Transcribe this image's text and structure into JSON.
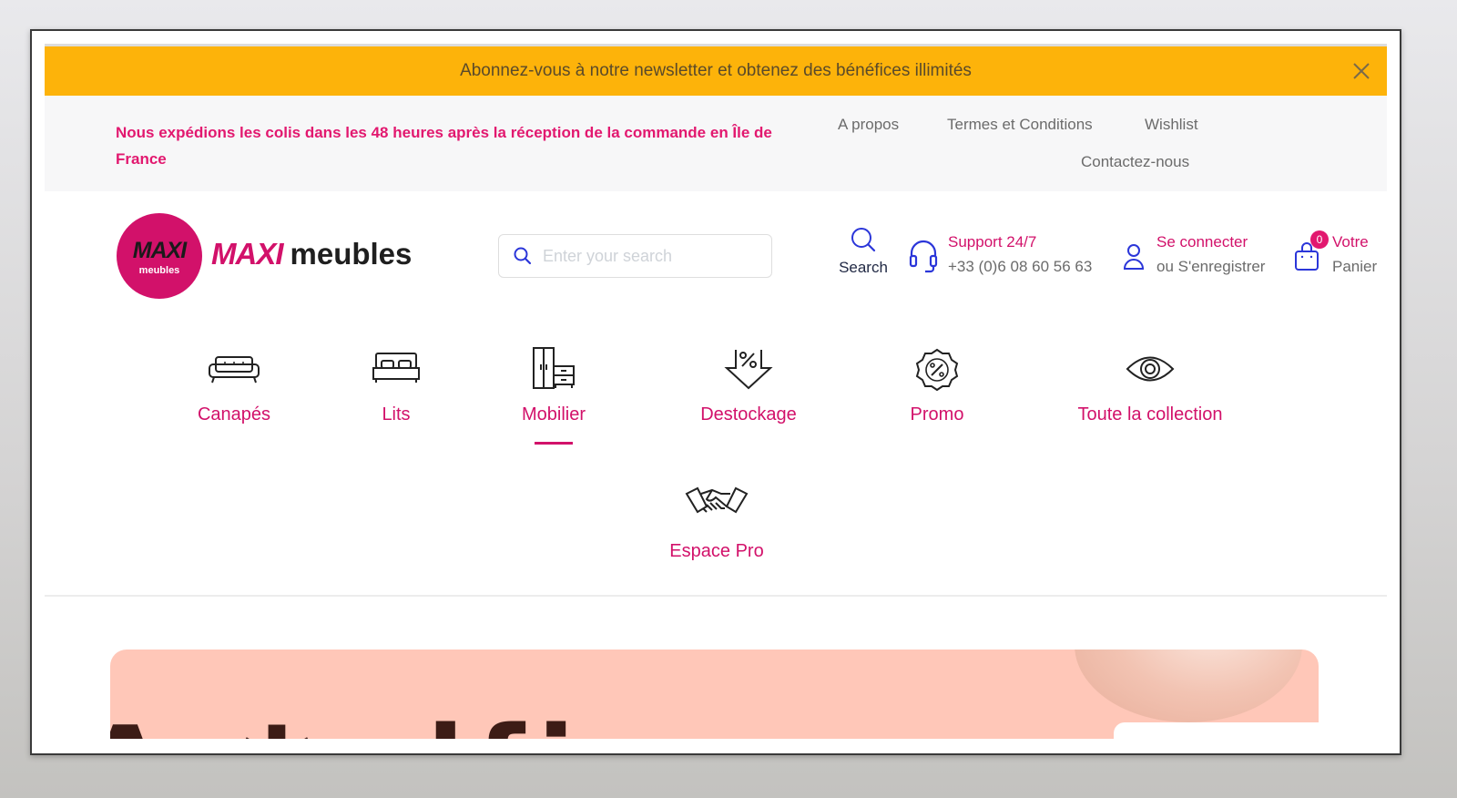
{
  "promo_bar": {
    "text": "Abonnez-vous à notre newsletter et obtenez des bénéfices illimités"
  },
  "info_bar": {
    "shipping_message": "Nous expédions les colis dans les 48 heures après la réception de la commande en Île de France",
    "links": [
      "A propos",
      "Termes et Conditions",
      "Wishlist",
      "Contactez-nous"
    ]
  },
  "logo": {
    "circle_top": "MAXI",
    "circle_bottom": "meubles",
    "word_brand": "MAXI",
    "word_suffix": "meubles"
  },
  "search": {
    "placeholder": "Enter your search",
    "button_label": "Search"
  },
  "support": {
    "title": "Support 24/7",
    "phone": "+33 (0)6 08 60 56 63"
  },
  "account": {
    "title": "Se connecter",
    "subtitle": "ou S'enregistrer"
  },
  "cart": {
    "count": "0",
    "title": "Votre",
    "subtitle": "Panier"
  },
  "categories": [
    {
      "label": "Canapés",
      "icon": "sofa-icon"
    },
    {
      "label": "Lits",
      "icon": "bed-icon"
    },
    {
      "label": "Mobilier",
      "icon": "cabinet-icon",
      "active": true
    },
    {
      "label": "Destockage",
      "icon": "discount-arrow-icon"
    },
    {
      "label": "Promo",
      "icon": "percent-badge-icon"
    },
    {
      "label": "Toute la collection",
      "icon": "eye-icon"
    },
    {
      "label": "Espace Pro",
      "icon": "handshake-icon"
    }
  ],
  "colors": {
    "brand": "#d2116a",
    "promo_bg": "#fdb30a",
    "hero_bg": "#ffc7b8",
    "icon_blue": "#2b36d9"
  }
}
